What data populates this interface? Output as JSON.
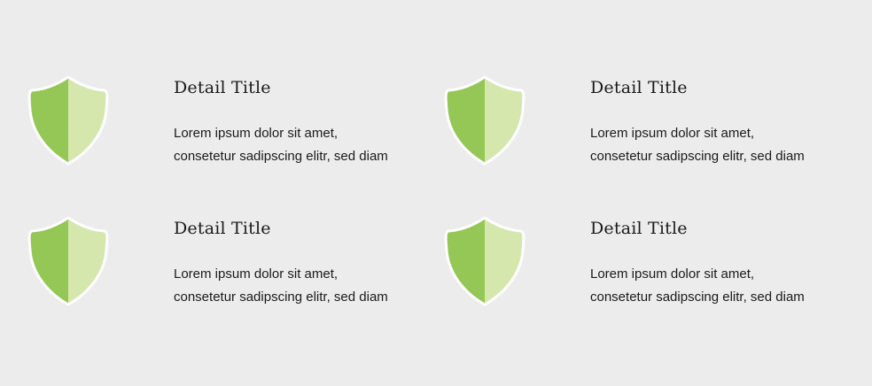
{
  "colors": {
    "background": "#ececec",
    "shield_left": "#94c756",
    "shield_right": "#d6e7ad",
    "shield_border": "#ffffff"
  },
  "features": [
    {
      "icon": "shield-icon",
      "title": "Detail Title",
      "desc_line1": "Lorem ipsum dolor sit amet,",
      "desc_line2": "consetetur sadipscing elitr, sed diam"
    },
    {
      "icon": "shield-icon",
      "title": "Detail Title",
      "desc_line1": "Lorem ipsum dolor sit amet,",
      "desc_line2": "consetetur sadipscing elitr, sed diam"
    },
    {
      "icon": "shield-icon",
      "title": "Detail Title",
      "desc_line1": "Lorem ipsum dolor sit amet,",
      "desc_line2": "consetetur sadipscing elitr, sed diam"
    },
    {
      "icon": "shield-icon",
      "title": "Detail Title",
      "desc_line1": "Lorem ipsum dolor sit amet,",
      "desc_line2": "consetetur sadipscing elitr, sed diam"
    }
  ]
}
